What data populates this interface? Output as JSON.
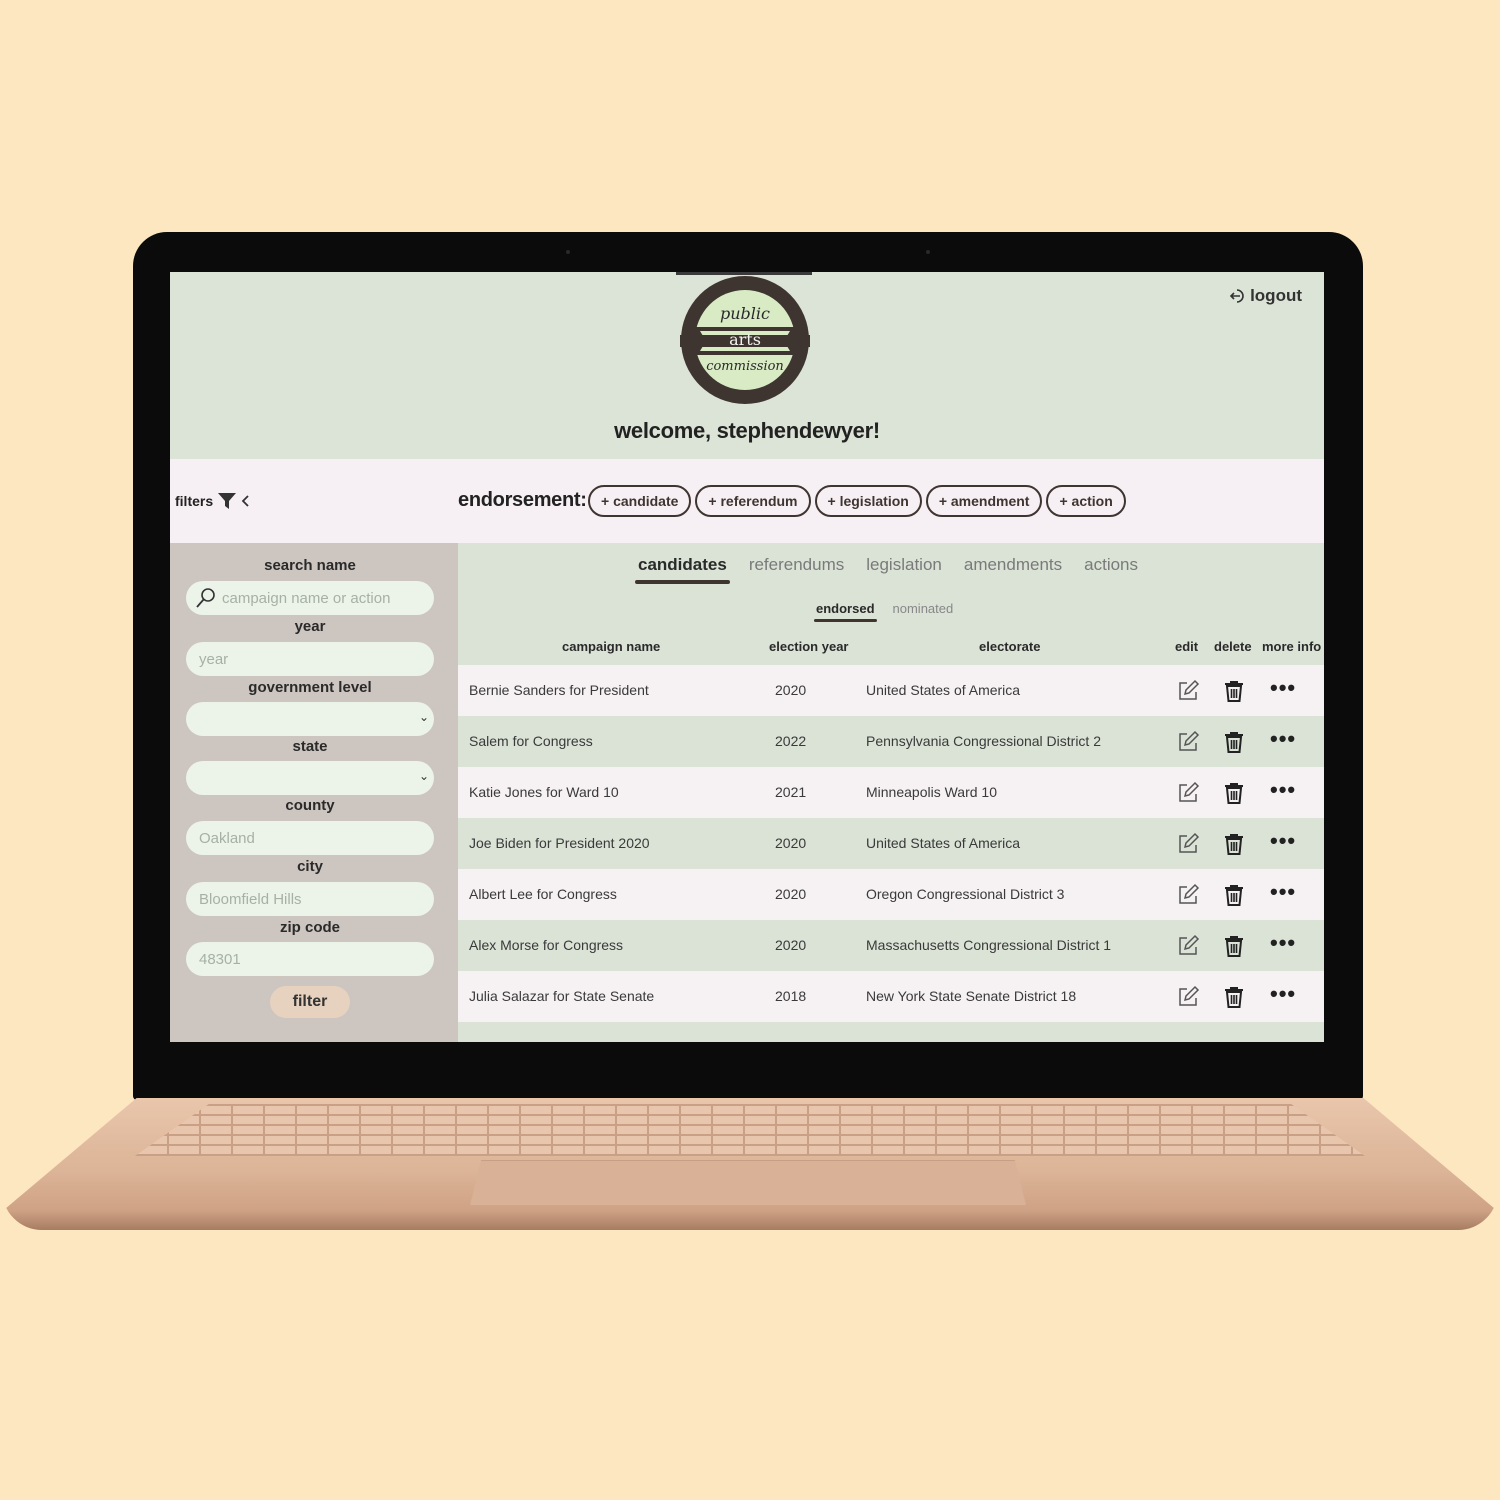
{
  "header": {
    "logo_lines": [
      "public",
      "arts",
      "commission"
    ],
    "welcome": "welcome, stephendewyer!",
    "logout_label": "logout"
  },
  "toolbar": {
    "filters_label": "filters",
    "endorsement_label": "endorsement:",
    "buttons": [
      "+ candidate",
      "+ referendum",
      "+ legislation",
      "+ amendment",
      "+ action"
    ]
  },
  "sidebar": {
    "search_label": "search name",
    "search_placeholder": "campaign name or action",
    "year_label": "year",
    "year_placeholder": "year",
    "gov_level_label": "government level",
    "state_label": "state",
    "county_label": "county",
    "county_placeholder": "Oakland",
    "city_label": "city",
    "city_placeholder": "Bloomfield Hills",
    "zip_label": "zip code",
    "zip_placeholder": "48301",
    "filter_button": "filter"
  },
  "main": {
    "tabs": [
      "candidates",
      "referendums",
      "legislation",
      "amendments",
      "actions"
    ],
    "subtabs": [
      "endorsed",
      "nominated"
    ],
    "columns": {
      "campaign_name": "campaign name",
      "election_year": "election year",
      "electorate": "electorate",
      "edit": "edit",
      "delete": "delete",
      "more_info": "more info"
    },
    "rows": [
      {
        "name": "Bernie Sanders for President",
        "year": "2020",
        "electorate": "United States of America"
      },
      {
        "name": "Salem for Congress",
        "year": "2022",
        "electorate": "Pennsylvania Congressional District 2"
      },
      {
        "name": "Katie Jones for Ward 10",
        "year": "2021",
        "electorate": "Minneapolis Ward 10"
      },
      {
        "name": "Joe Biden for President 2020",
        "year": "2020",
        "electorate": "United States of America"
      },
      {
        "name": "Albert Lee for Congress",
        "year": "2020",
        "electorate": "Oregon Congressional District 3"
      },
      {
        "name": "Alex Morse for Congress",
        "year": "2020",
        "electorate": "Massachusetts Congressional District 1"
      },
      {
        "name": "Julia Salazar for State Senate",
        "year": "2018",
        "electorate": "New York State Senate District 18"
      }
    ],
    "more_glyph": "•••"
  },
  "colors": {
    "background": "#fde7c0",
    "header": "#dce4d7",
    "toolbar": "#f6eff3",
    "sidebar": "#cdc5c0",
    "accent_dark": "#3e3531",
    "logo_green": "#d8ebc4"
  }
}
